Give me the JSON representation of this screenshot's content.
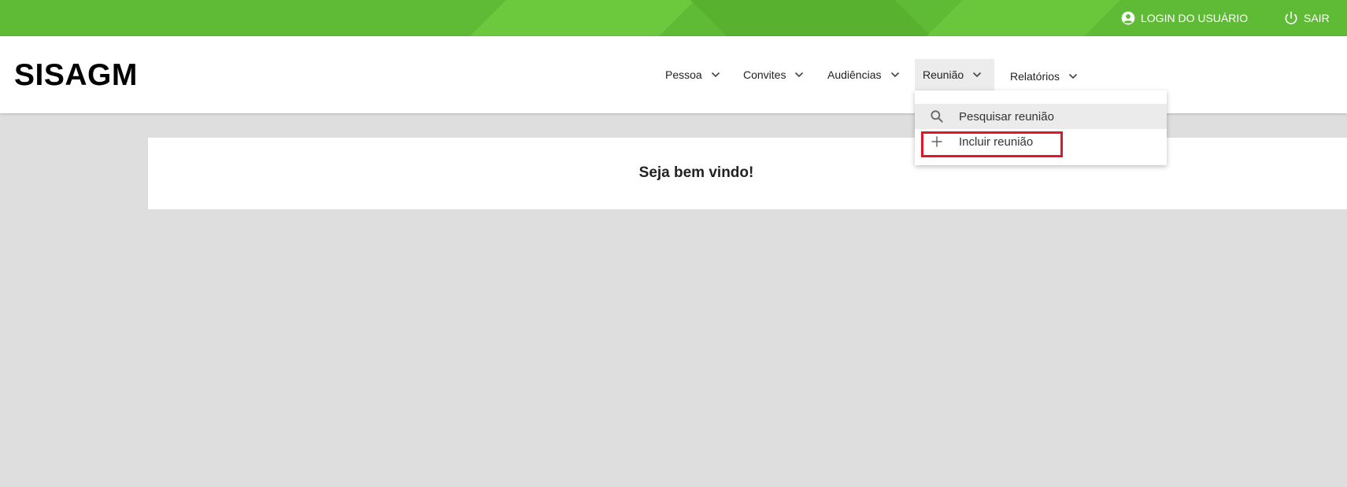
{
  "topbar": {
    "login_label": "LOGIN DO USUÁRIO",
    "logout_label": "SAIR",
    "login_icon": "account-circle-icon",
    "logout_icon": "power-icon",
    "color": "#5fbb35"
  },
  "header": {
    "brand": "SISAGM"
  },
  "nav": {
    "items": [
      {
        "label": "Pessoa"
      },
      {
        "label": "Convites"
      },
      {
        "label": "Audiências"
      },
      {
        "label": "Reunião"
      },
      {
        "label": "Relatórios"
      }
    ],
    "active_index": 3
  },
  "dropdown": {
    "items": [
      {
        "label": "Pesquisar reunião",
        "icon": "search-icon"
      },
      {
        "label": "Incluir reunião",
        "icon": "plus-icon"
      }
    ],
    "highlight_color": "#e0162b"
  },
  "main": {
    "welcome": "Seja bem vindo!"
  }
}
